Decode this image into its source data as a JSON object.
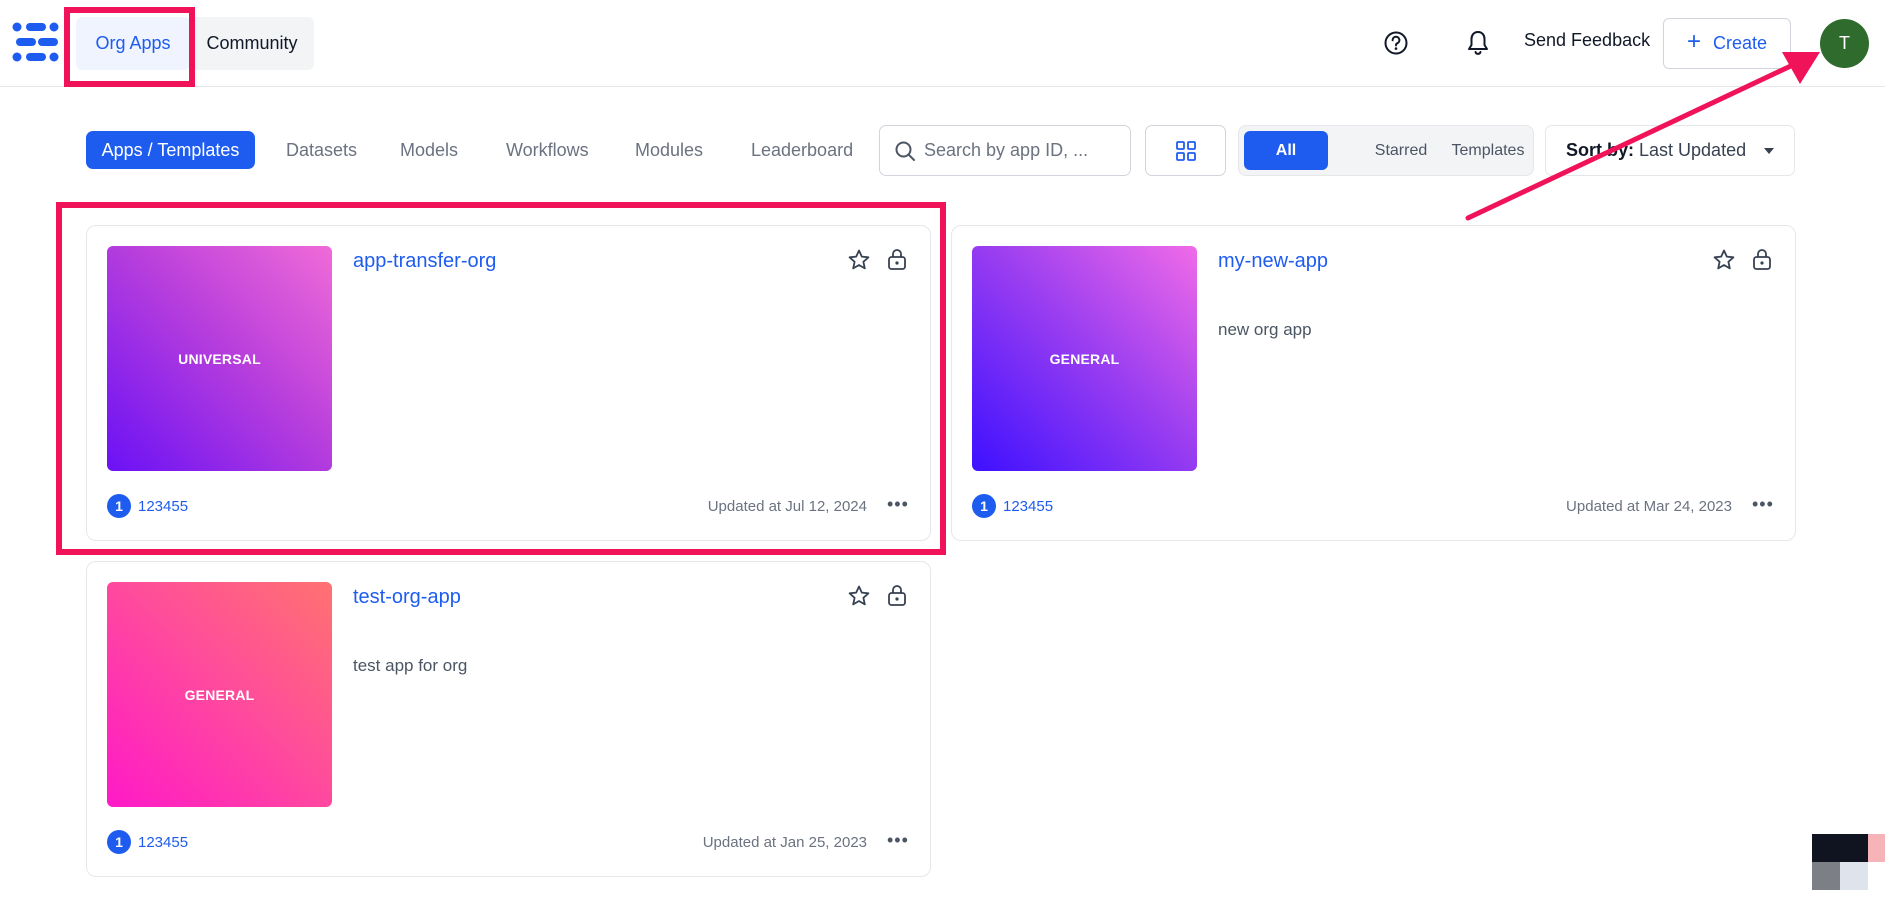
{
  "header": {
    "nav_tabs": [
      {
        "label": "Org Apps",
        "active": true
      },
      {
        "label": "Community",
        "active": false
      }
    ],
    "send_feedback": "Send Feedback",
    "create_label": "Create",
    "avatar_initial": "T"
  },
  "filters": {
    "tabs": [
      {
        "label": "Apps / Templates",
        "active": true
      },
      {
        "label": "Datasets"
      },
      {
        "label": "Models"
      },
      {
        "label": "Workflows"
      },
      {
        "label": "Modules"
      },
      {
        "label": "Leaderboard"
      }
    ],
    "search_placeholder": "Search by app ID, ...",
    "segments": [
      {
        "label": "All",
        "active": true
      },
      {
        "label": "Starred"
      },
      {
        "label": "Templates"
      }
    ],
    "sort_label": "Sort by:",
    "sort_value": "Last Updated"
  },
  "apps": [
    {
      "title": "app-transfer-org",
      "thumbnail_label": "UNIVERSAL",
      "description": "",
      "badge": "1",
      "owner": "123455",
      "updated": "Updated at Jul 12, 2024"
    },
    {
      "title": "my-new-app",
      "thumbnail_label": "GENERAL",
      "description": "new org app",
      "badge": "1",
      "owner": "123455",
      "updated": "Updated at Mar 24, 2023"
    },
    {
      "title": "test-org-app",
      "thumbnail_label": "GENERAL",
      "description": "test app for org",
      "badge": "1",
      "owner": "123455",
      "updated": "Updated at Jan 25, 2023"
    }
  ],
  "colors": {
    "accent": "#1e5cf0",
    "annotation": "#f0135a",
    "avatar": "#2f6b2d"
  },
  "icons": [
    "logo-icon",
    "help-icon",
    "bell-icon",
    "plus-icon",
    "search-icon",
    "grid-icon",
    "caret-down-icon",
    "star-icon",
    "lock-icon",
    "more-icon"
  ]
}
